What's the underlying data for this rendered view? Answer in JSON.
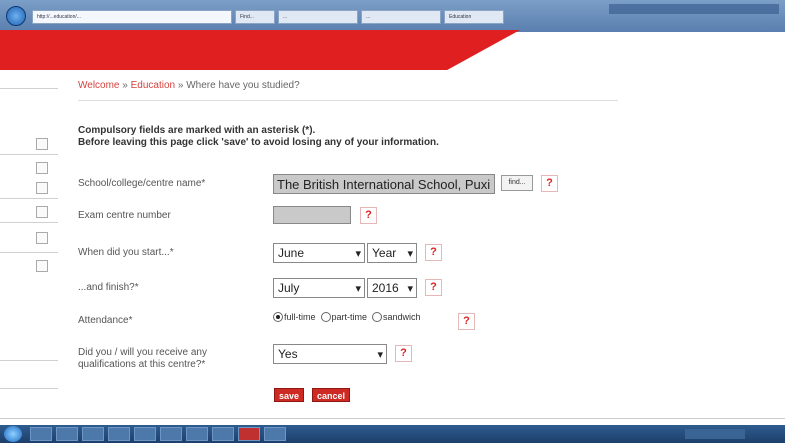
{
  "browser": {
    "tabs": [
      "http://...education/...",
      "Find...",
      "...",
      "...",
      "Education"
    ]
  },
  "breadcrumb": {
    "item1": "Welcome",
    "sep1": " » ",
    "item2": "Education",
    "sep2": " » ",
    "current": "Where have you studied?"
  },
  "notice": {
    "line1": "Compulsory fields are marked with an asterisk (*).",
    "line2": "Before leaving this page click 'save' to avoid losing any of your information."
  },
  "form": {
    "school": {
      "label": "School/college/centre name*",
      "value": "The British International School, Puxi",
      "find_label": "find..."
    },
    "exam_centre": {
      "label": "Exam centre number",
      "value": ""
    },
    "start": {
      "label": "When did you start...*",
      "month": "June",
      "year": "Year"
    },
    "finish": {
      "label": "...and finish?*",
      "month": "July",
      "year": "2016"
    },
    "attendance": {
      "label": "Attendance*",
      "options": [
        "full-time",
        "part-time",
        "sandwich"
      ],
      "selected": "full-time"
    },
    "qualifications": {
      "label": "Did you / will you receive any qualifications at this centre?*",
      "value": "Yes"
    },
    "help_label": "?",
    "caret": "▾"
  },
  "actions": {
    "save": "save",
    "cancel": "cancel"
  }
}
